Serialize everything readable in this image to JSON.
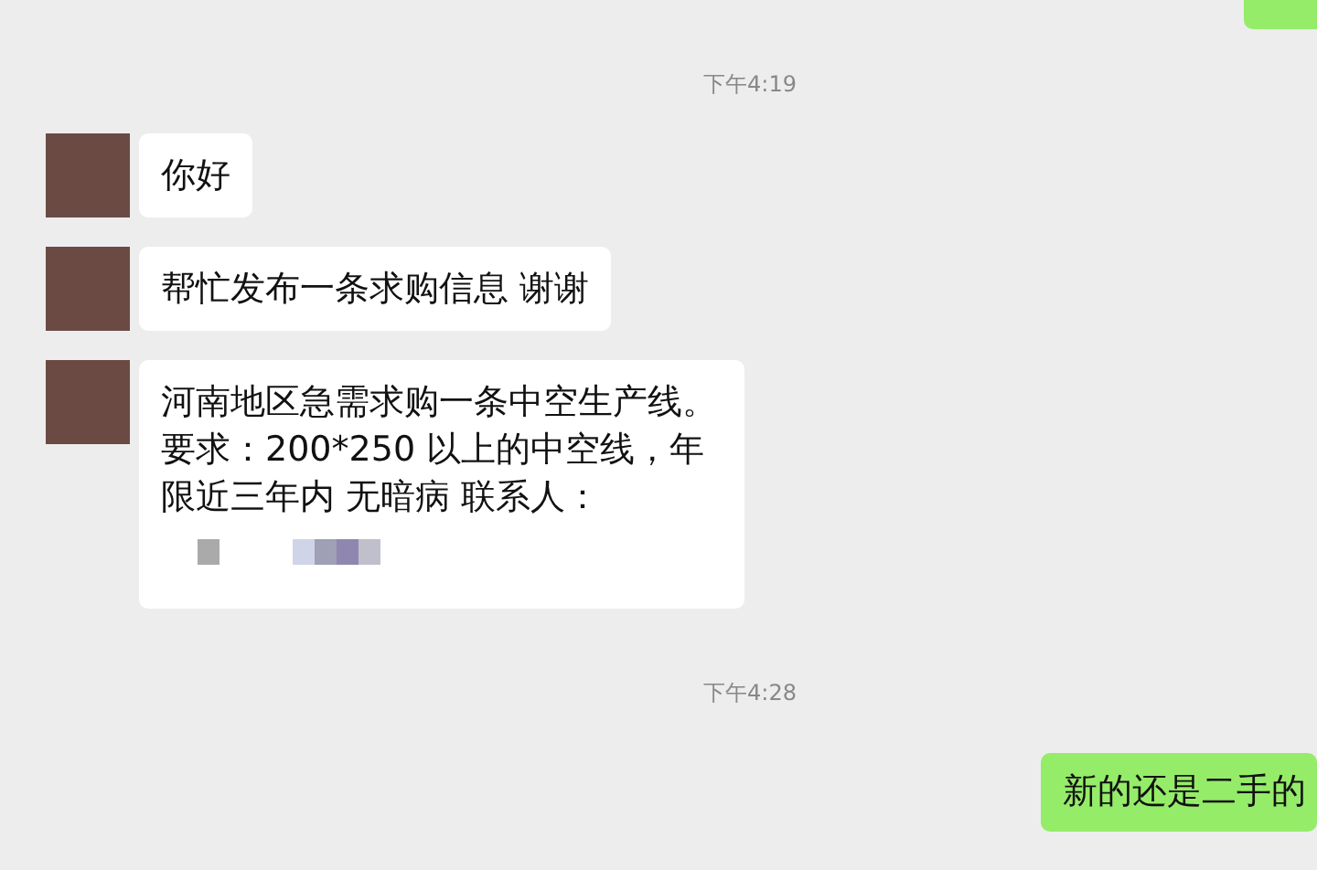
{
  "items": [
    {
      "kind": "outgoing-cut"
    },
    {
      "kind": "time",
      "text": "下午4:19"
    },
    {
      "kind": "incoming",
      "text": "你好",
      "redacted": false
    },
    {
      "kind": "incoming",
      "text": "帮忙发布一条求购信息  谢谢",
      "redacted": false
    },
    {
      "kind": "incoming",
      "text": "河南地区急需求购一条中空生产线。要求：200*250 以上的中空线，年限近三年内 无暗病 联系人：",
      "redacted": true
    },
    {
      "kind": "time",
      "text": "下午4:28"
    },
    {
      "kind": "outgoing",
      "text": "新的还是二手的"
    }
  ]
}
